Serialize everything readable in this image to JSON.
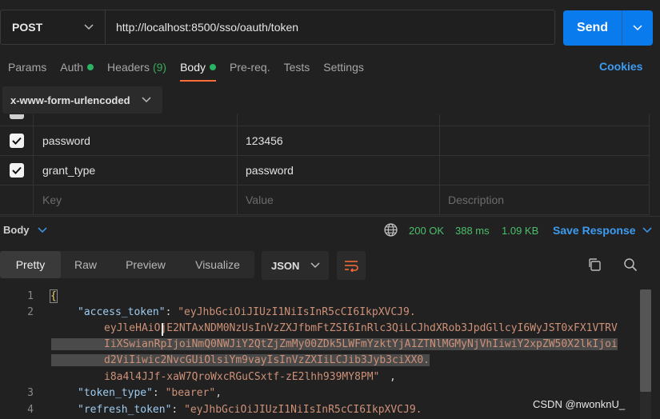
{
  "request": {
    "method": "POST",
    "url": "http://localhost:8500/sso/oauth/token",
    "send_label": "Send"
  },
  "tabs": [
    {
      "label": "Params"
    },
    {
      "label": "Auth",
      "dot": true
    },
    {
      "label": "Headers",
      "count": "(9)"
    },
    {
      "label": "Body",
      "dot": true,
      "active": true
    },
    {
      "label": "Pre-req."
    },
    {
      "label": "Tests"
    },
    {
      "label": "Settings"
    }
  ],
  "cookies_label": "Cookies",
  "body_type": "x-www-form-urlencoded",
  "params": {
    "rows": [
      {
        "key": "password",
        "value": "123456",
        "checked": true
      },
      {
        "key": "grant_type",
        "value": "password",
        "checked": true
      }
    ],
    "placeholder_key": "Key",
    "placeholder_value": "Value",
    "placeholder_description": "Description"
  },
  "response": {
    "label": "Body",
    "status": "200 OK",
    "time": "388 ms",
    "size": "1.09 KB",
    "save_label": "Save Response",
    "view_tabs": [
      "Pretty",
      "Raw",
      "Preview",
      "Visualize"
    ],
    "active_view": "Pretty",
    "format": "JSON"
  },
  "code": {
    "line_numbers": [
      "1",
      "2",
      "3",
      "4"
    ],
    "brace": "{",
    "access_token_key": "\"access_token\"",
    "access_token_parts": [
      "\"eyJhbGciOiJIUzI1NiIsInR5cCI6IkpXVCJ9.",
      "eyJleHAiOjE2NTAxNDM0NzUsInVzZXJfbmFtZSI6InRlc3QiLCJhdXRob3JpdGllcyI6WyJST0xFX1VTRV",
      "IiXSwianRpIjoiNmQ0NWJiY2QtZjZmMy00ZDk5LWFmYzktYjA1ZTNlMGMyNjVhIiwiY2xpZW50X2lkIjoi",
      "d2ViIiwic2NvcGUiOlsiYm9vayIsInVzZXIiLCJib3Jyb3ciXX0.",
      "i8a4l4JJf-xaW7QroWxcRGuCSxtf-zE2lhh939MY8PM\""
    ],
    "token_type_key": "\"token_type\"",
    "token_type_value": "\"bearer\"",
    "refresh_token_key": "\"refresh_token\"",
    "refresh_token_value": "\"eyJhbGciOiJIUzI1NiIsInR5cCI6IkpXVCJ9."
  },
  "watermark": "CSDN @nwonknU_",
  "colors": {
    "accent_send": "#097bed",
    "active_tab_underline": "#ff6c37",
    "status_green": "#4cbf6b",
    "link_blue": "#3d9bf0"
  }
}
